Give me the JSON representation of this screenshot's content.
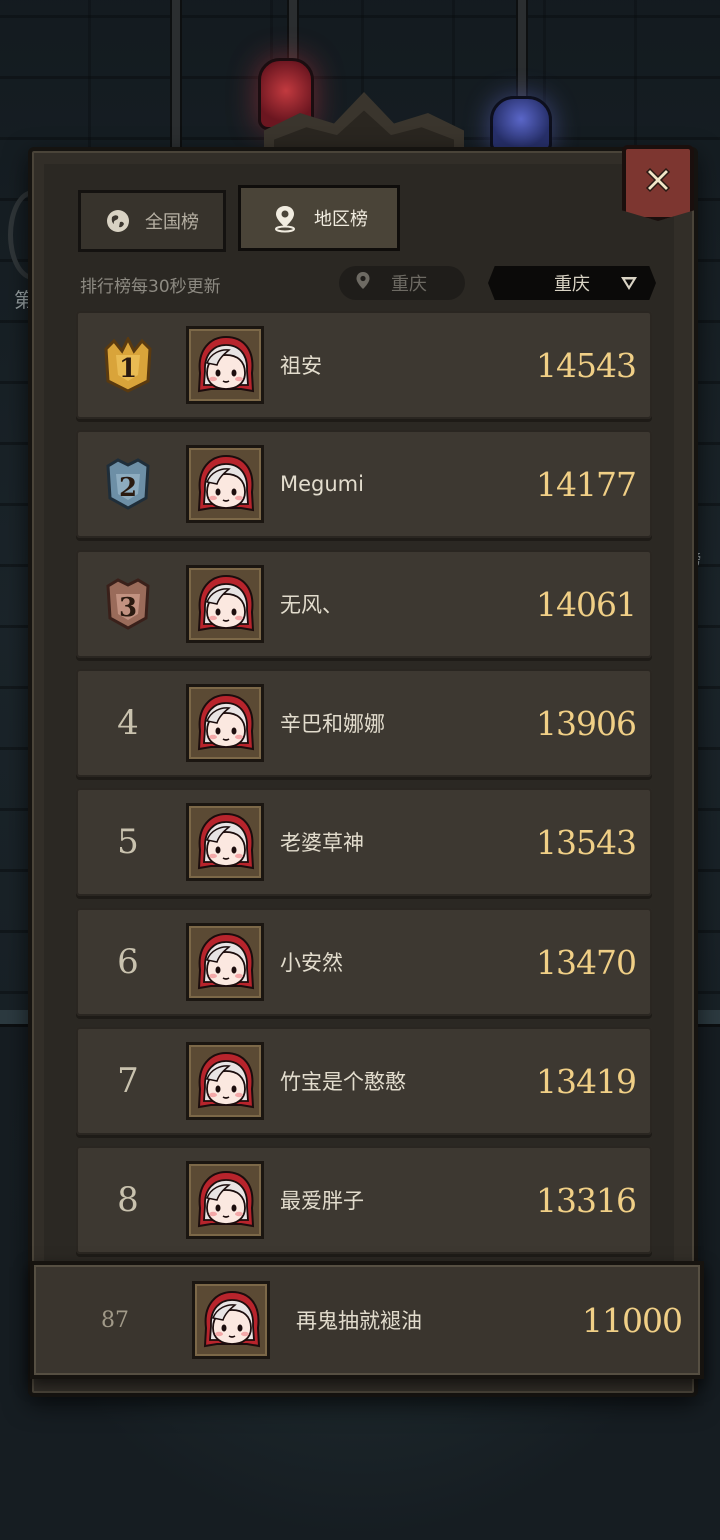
{
  "tabs": {
    "national": "全国榜",
    "region": "地区榜"
  },
  "update_note": "排行榜每30秒更新",
  "current_location": "重庆",
  "region_select": "重庆",
  "side_text": {
    "left": "第",
    "right": "榜"
  },
  "rows": [
    {
      "rank": "1",
      "name": "祖安",
      "score": "14543"
    },
    {
      "rank": "2",
      "name": "Megumi",
      "score": "14177"
    },
    {
      "rank": "3",
      "name": "无风、",
      "score": "14061"
    },
    {
      "rank": "4",
      "name": "辛巴和娜娜",
      "score": "13906"
    },
    {
      "rank": "5",
      "name": "老婆草神",
      "score": "13543"
    },
    {
      "rank": "6",
      "name": "小安然",
      "score": "13470"
    },
    {
      "rank": "7",
      "name": "竹宝是个憨憨",
      "score": "13419"
    },
    {
      "rank": "8",
      "name": "最爱胖子",
      "score": "13316"
    }
  ],
  "my_entry": {
    "rank": "87",
    "name": "再鬼抽就褪油",
    "score": "11000"
  },
  "colors": {
    "gold": "#d9a43a",
    "silver": "#6d8fa6",
    "bronze": "#9a6b5a",
    "score": "#f0cf86",
    "close_button": "#7d3630"
  }
}
